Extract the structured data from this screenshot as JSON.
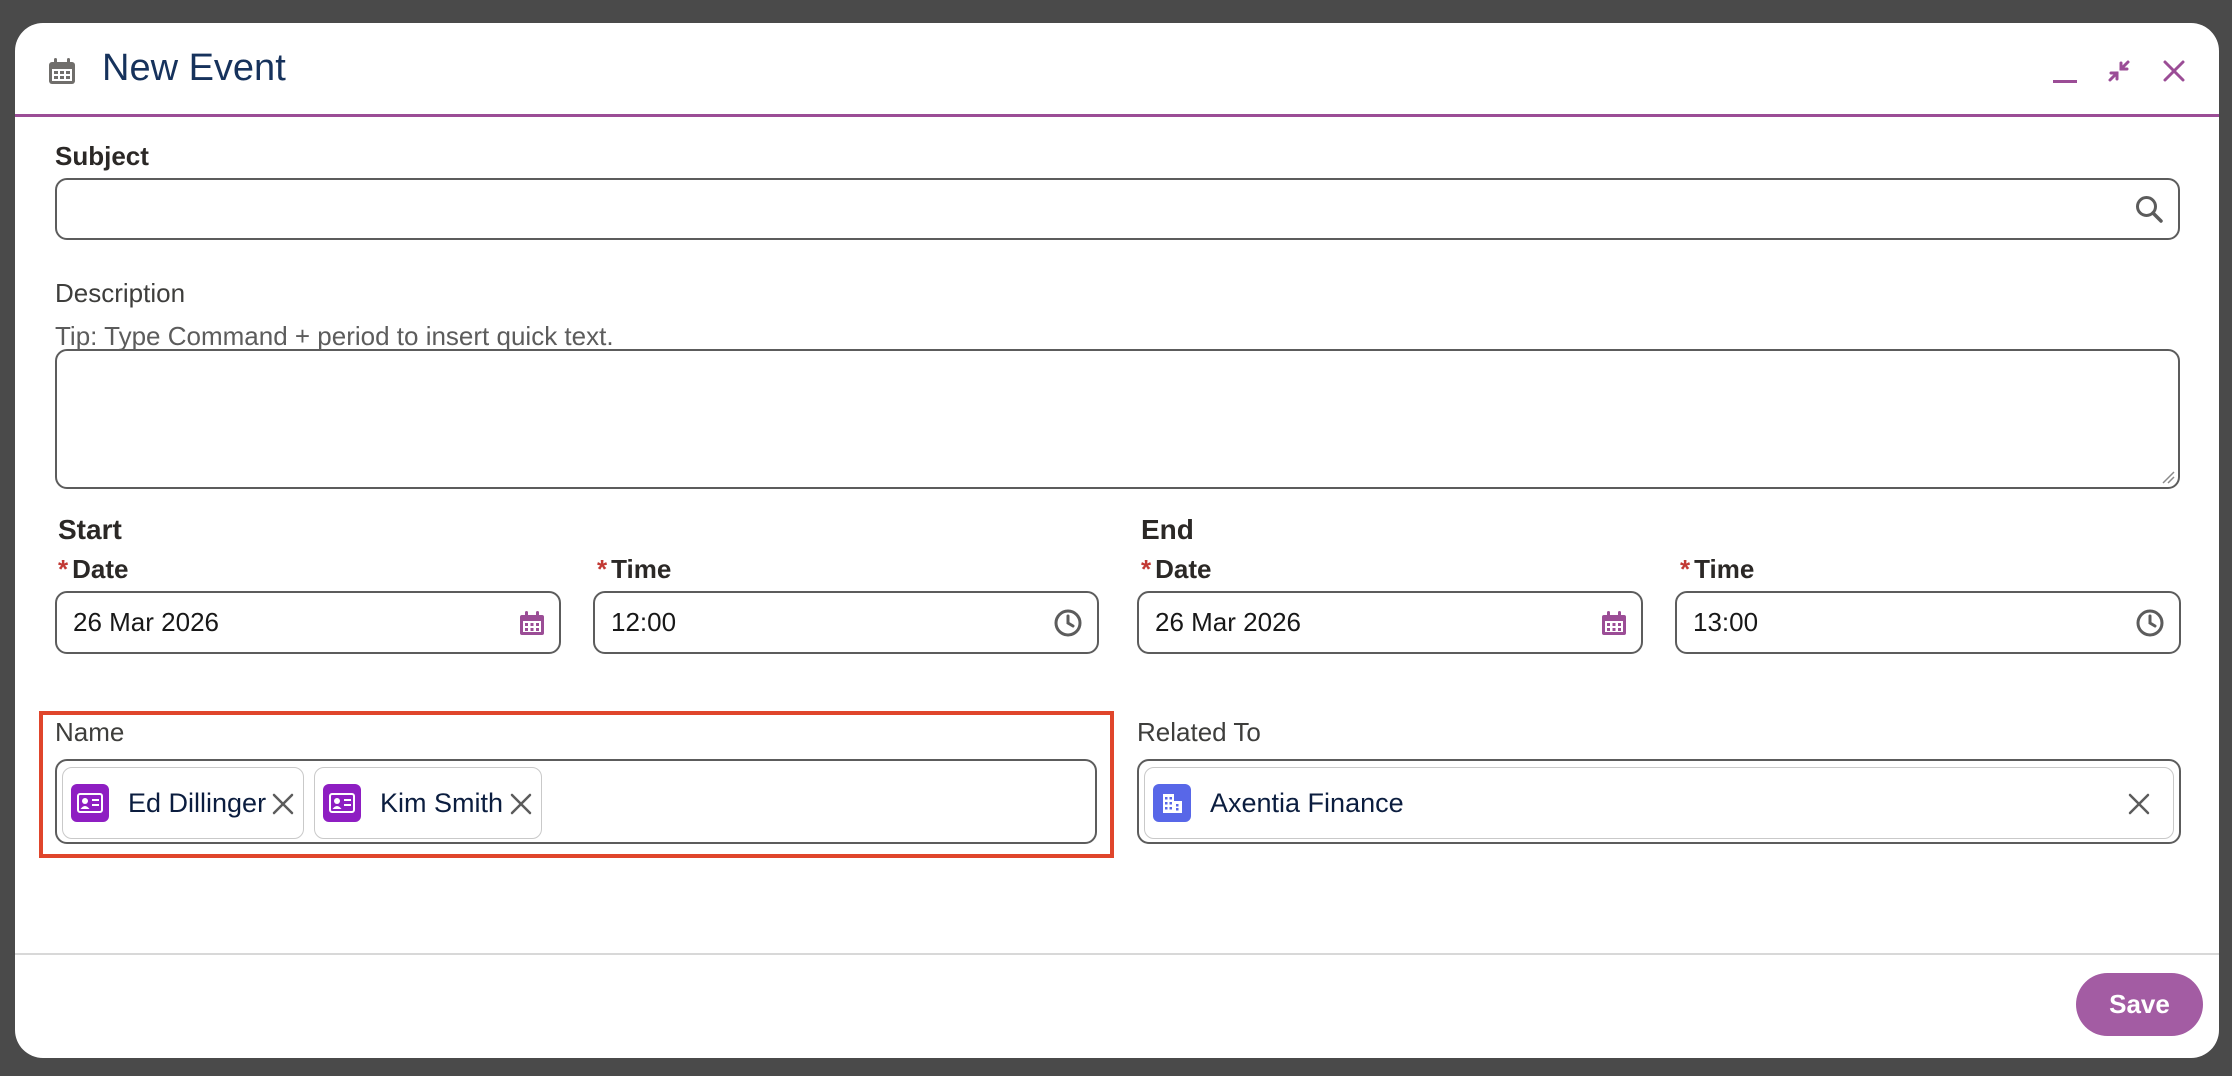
{
  "header": {
    "title": "New Event",
    "icon": "calendar-icon",
    "buttons": [
      "minimize-icon",
      "collapse-icon",
      "close-icon"
    ]
  },
  "subject": {
    "label": "Subject",
    "value": "",
    "icon": "search-icon"
  },
  "description": {
    "label": "Description",
    "tip": "Tip: Type Command + period to insert quick text.",
    "value": ""
  },
  "start": {
    "section_label": "Start",
    "date_label": "Date",
    "date_value": "26 Mar 2026",
    "time_label": "Time",
    "time_value": "12:00",
    "required_mark": "*"
  },
  "end": {
    "section_label": "End",
    "date_label": "Date",
    "date_value": "26 Mar 2026",
    "time_label": "Time",
    "time_value": "13:00",
    "required_mark": "*"
  },
  "name": {
    "label": "Name",
    "pills": [
      "Ed Dillinger",
      "Kim Smith"
    ]
  },
  "related_to": {
    "label": "Related To",
    "value": "Axentia Finance"
  },
  "footer": {
    "save_label": "Save"
  },
  "colors": {
    "accent": "#9b4d96",
    "save_button": "#a35ca3",
    "contact_icon": "#8e1ec2",
    "account_icon": "#5867e8",
    "highlight": "#e0452b"
  }
}
